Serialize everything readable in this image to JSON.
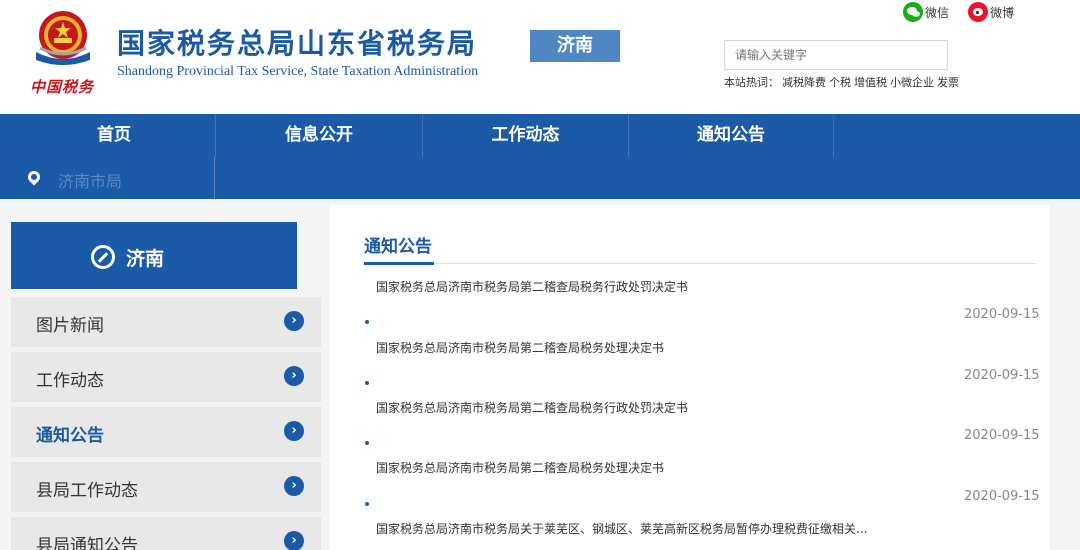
{
  "header": {
    "title": "国家税务总局山东省税务局",
    "subtitle": "Shandong Provincial Tax Service, State Taxation Administration",
    "logo_script": "中国税务",
    "city": "济南",
    "social": {
      "wechat": "微信",
      "weibo": "微博"
    },
    "search_placeholder": "请输入关键字",
    "hot_label": "本站热词：",
    "hot_words": [
      "减税降费",
      "个税",
      "增值税",
      "小微企业",
      "发票"
    ]
  },
  "nav": {
    "items": [
      "首页",
      "信息公开",
      "工作动态",
      "通知公告"
    ]
  },
  "breadcrumb": {
    "text": "济南市局"
  },
  "sidebar": {
    "region": "济南",
    "items": [
      {
        "label": "图片新闻"
      },
      {
        "label": "工作动态"
      },
      {
        "label": "通知公告"
      },
      {
        "label": "县局工作动态"
      },
      {
        "label": "县局通知公告"
      }
    ],
    "active_index": 2,
    "arrow": "›"
  },
  "main": {
    "title": "通知公告",
    "items": [
      {
        "title": "国家税务总局济南市税务局第二稽查局税务行政处罚决定书",
        "date": "2020-09-15"
      },
      {
        "title": "国家税务总局济南市税务局第二稽查局税务处理决定书",
        "date": "2020-09-15"
      },
      {
        "title": "国家税务总局济南市税务局第二稽查局税务行政处罚决定书",
        "date": "2020-09-15"
      },
      {
        "title": "国家税务总局济南市税务局第二稽查局税务处理决定书",
        "date": "2020-09-15"
      },
      {
        "title": "国家税务总局济南市税务局关于莱芜区、钢城区、莱芜高新区税务局暂停办理税费征缴相关...",
        "date": ""
      }
    ]
  },
  "colors": {
    "primary": "#1b5aa6",
    "accent_red": "#c8161d",
    "badge": "#4f87c5"
  }
}
